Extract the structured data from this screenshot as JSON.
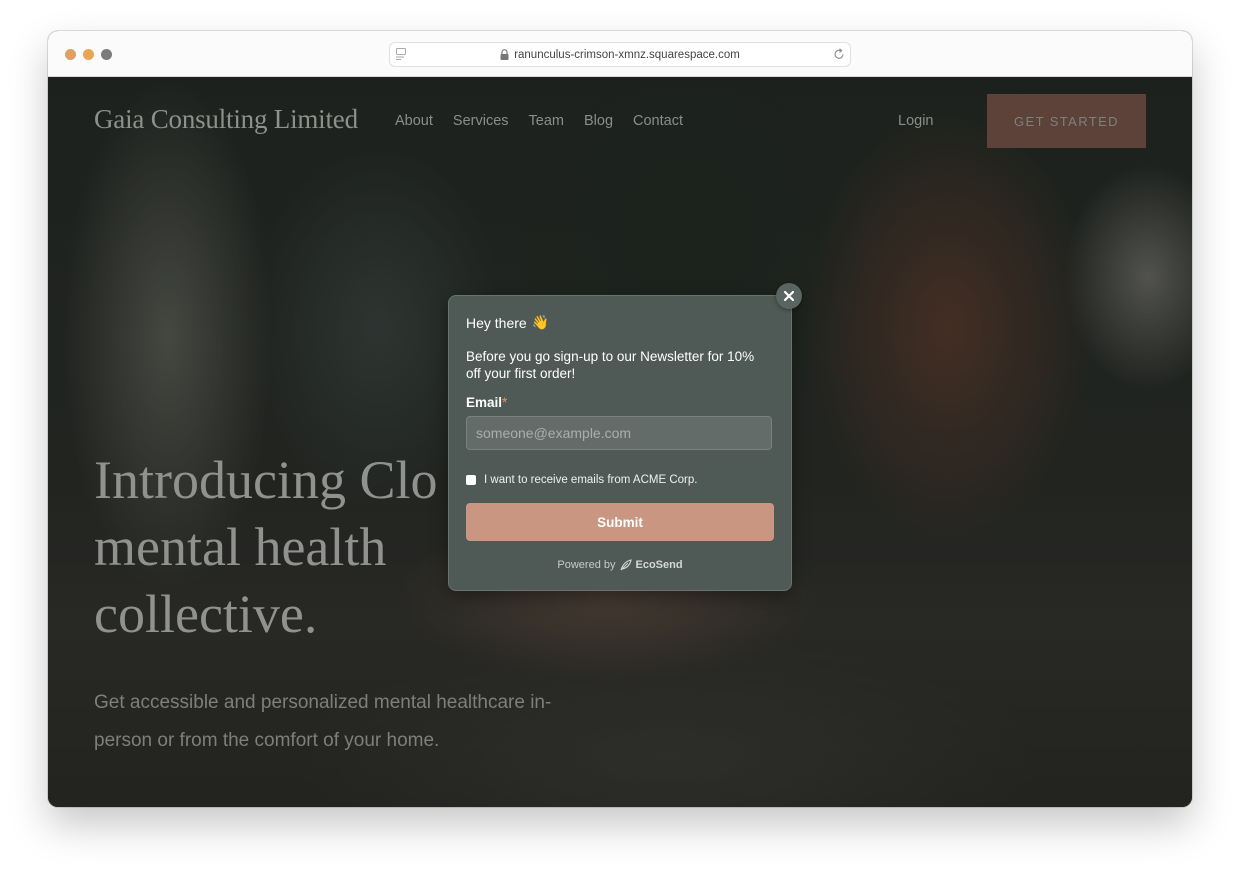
{
  "browser": {
    "url": "ranunculus-crimson-xmnz.squarespace.com",
    "traffic_colors": {
      "close": "#e0a062",
      "minimize": "#eda452",
      "maximize": "#7b7b7b"
    }
  },
  "site": {
    "logo": "Gaia Consulting Limited",
    "nav": [
      "About",
      "Services",
      "Team",
      "Blog",
      "Contact"
    ],
    "login": "Login",
    "cta": "GET STARTED",
    "hero": {
      "title_lines": [
        "Introducing Clo",
        "mental health",
        "collective."
      ],
      "subtitle": "Get accessible and personalized mental healthcare in-person or from the comfort of your home."
    }
  },
  "popup": {
    "greeting": "Hey there",
    "greeting_emoji": "👋",
    "description": "Before you go sign-up to our Newsletter for 10% off your first order!",
    "email_label": "Email",
    "required_marker": "*",
    "email_placeholder": "someone@example.com",
    "email_value": "",
    "consent_label": "I want to receive emails from ACME Corp.",
    "consent_checked": false,
    "submit_label": "Submit",
    "powered_by": "Powered by",
    "powered_brand": "EcoSend",
    "accent_color": "#c99682",
    "close_icon": "close-icon"
  }
}
